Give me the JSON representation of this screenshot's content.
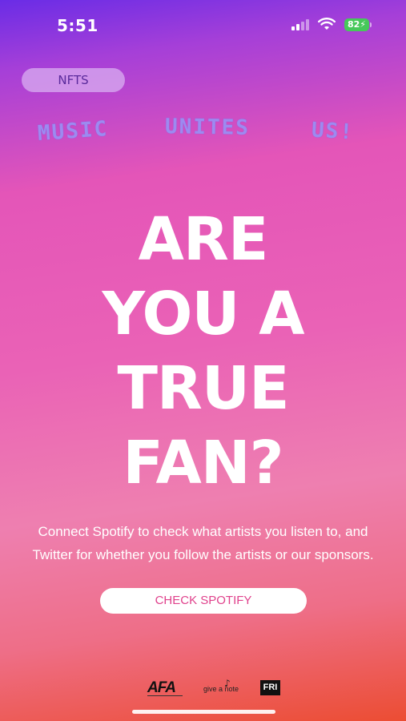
{
  "status_bar": {
    "time": "5:51",
    "battery": "82"
  },
  "nav": {
    "nfts_label": "NFTS"
  },
  "tagline": {
    "words": [
      "MUSIC",
      "UNITES",
      "US!"
    ]
  },
  "headline": {
    "lines": [
      "ARE",
      "YOU A",
      "TRUE",
      "FAN?"
    ]
  },
  "description": "Connect Spotify to check what artists you listen to, and Twitter for whether you follow the artists or our sponsors.",
  "cta": {
    "label": "CHECK SPOTIFY"
  },
  "sponsors": [
    {
      "name": "AFA"
    },
    {
      "name": "give a note"
    },
    {
      "name": "FRI"
    }
  ],
  "colors": {
    "gradient_top": "#6a2ce6",
    "gradient_mid": "#e455b8",
    "gradient_bottom": "#ec4d33",
    "tagline": "#9d8af0",
    "cta_text": "#e0418c",
    "battery": "#46c85a"
  }
}
